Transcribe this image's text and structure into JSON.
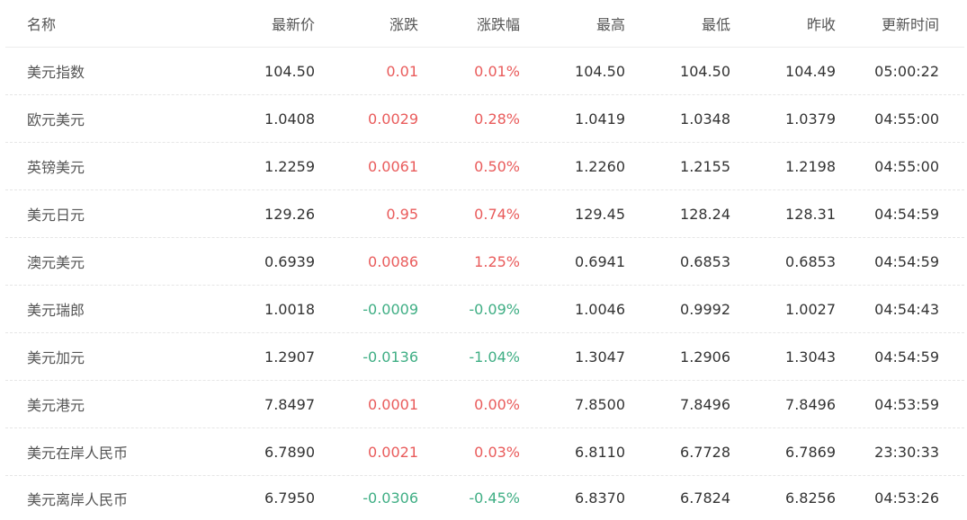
{
  "colors": {
    "up": "#e95b5b",
    "down": "#3fae84",
    "text": "#333333",
    "divider": "#e6e6e6"
  },
  "table": {
    "headers": {
      "name": "名称",
      "last": "最新价",
      "change": "涨跌",
      "change_pct": "涨跌幅",
      "high": "最高",
      "low": "最低",
      "prev_close": "昨收",
      "update_time": "更新时间"
    },
    "rows": [
      {
        "name": "美元指数",
        "last": "104.50",
        "change": "0.01",
        "change_pct": "0.01%",
        "high": "104.50",
        "low": "104.50",
        "prev_close": "104.49",
        "update_time": "05:00:22",
        "trend": "up"
      },
      {
        "name": "欧元美元",
        "last": "1.0408",
        "change": "0.0029",
        "change_pct": "0.28%",
        "high": "1.0419",
        "low": "1.0348",
        "prev_close": "1.0379",
        "update_time": "04:55:00",
        "trend": "up"
      },
      {
        "name": "英镑美元",
        "last": "1.2259",
        "change": "0.0061",
        "change_pct": "0.50%",
        "high": "1.2260",
        "low": "1.2155",
        "prev_close": "1.2198",
        "update_time": "04:55:00",
        "trend": "up"
      },
      {
        "name": "美元日元",
        "last": "129.26",
        "change": "0.95",
        "change_pct": "0.74%",
        "high": "129.45",
        "low": "128.24",
        "prev_close": "128.31",
        "update_time": "04:54:59",
        "trend": "up"
      },
      {
        "name": "澳元美元",
        "last": "0.6939",
        "change": "0.0086",
        "change_pct": "1.25%",
        "high": "0.6941",
        "low": "0.6853",
        "prev_close": "0.6853",
        "update_time": "04:54:59",
        "trend": "up"
      },
      {
        "name": "美元瑞郎",
        "last": "1.0018",
        "change": "-0.0009",
        "change_pct": "-0.09%",
        "high": "1.0046",
        "low": "0.9992",
        "prev_close": "1.0027",
        "update_time": "04:54:43",
        "trend": "down"
      },
      {
        "name": "美元加元",
        "last": "1.2907",
        "change": "-0.0136",
        "change_pct": "-1.04%",
        "high": "1.3047",
        "low": "1.2906",
        "prev_close": "1.3043",
        "update_time": "04:54:59",
        "trend": "down"
      },
      {
        "name": "美元港元",
        "last": "7.8497",
        "change": "0.0001",
        "change_pct": "0.00%",
        "high": "7.8500",
        "low": "7.8496",
        "prev_close": "7.8496",
        "update_time": "04:53:59",
        "trend": "up"
      },
      {
        "name": "美元在岸人民币",
        "last": "6.7890",
        "change": "0.0021",
        "change_pct": "0.03%",
        "high": "6.8110",
        "low": "6.7728",
        "prev_close": "6.7869",
        "update_time": "23:30:33",
        "trend": "up"
      },
      {
        "name": "美元离岸人民币",
        "last": "6.7950",
        "change": "-0.0306",
        "change_pct": "-0.45%",
        "high": "6.8370",
        "low": "6.7824",
        "prev_close": "6.8256",
        "update_time": "04:53:26",
        "trend": "down"
      }
    ]
  }
}
